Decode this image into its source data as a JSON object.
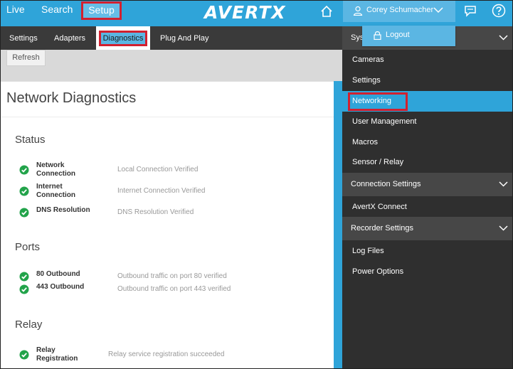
{
  "topnav": {
    "live": "Live",
    "search": "Search",
    "setup": "Setup",
    "logo": "AVERTX",
    "user_name": "Corey Schumacher",
    "logout": "Logout"
  },
  "subnav": {
    "tabs": [
      "Settings",
      "Adapters",
      "Diagnostics",
      "Plug And Play"
    ],
    "active": "Diagnostics"
  },
  "toolbar": {
    "refresh": "Refresh"
  },
  "main": {
    "title": "Network Diagnostics",
    "sections": [
      {
        "title": "Status",
        "rows": [
          {
            "label": "Network Connection",
            "value": "Local Connection Verified"
          },
          {
            "label": "Internet Connection",
            "value": "Internet Connection Verified"
          },
          {
            "label": "DNS Resolution",
            "value": "DNS Resolution Verified"
          }
        ]
      },
      {
        "title": "Ports",
        "rows": [
          {
            "label": "80 Outbound",
            "value": "Outbound traffic on port 80 verified"
          },
          {
            "label": "443 Outbound",
            "value": "Outbound traffic on port 443 verified"
          }
        ]
      },
      {
        "title": "Relay",
        "rows": [
          {
            "label": "Relay Registration",
            "value": "Relay service registration succeeded"
          }
        ]
      }
    ]
  },
  "sidebar": {
    "system_header": "Sys",
    "system_items": [
      "Cameras",
      "Settings",
      "Networking",
      "User Management",
      "Macros",
      "Sensor / Relay"
    ],
    "active_item": "Networking",
    "connection_header": "Connection Settings",
    "connection_items": [
      "AvertX Connect"
    ],
    "recorder_header": "Recorder Settings",
    "recorder_items": [
      "Log Files",
      "Power Options"
    ]
  },
  "colors": {
    "accent_blue": "#2fa4d9",
    "highlight_red": "#d2202f",
    "status_green": "#22a34a",
    "dark_panel": "#2f2f2f"
  },
  "icons": [
    "home-icon",
    "user-icon",
    "chevron-down-icon",
    "chat-icon",
    "help-icon",
    "lock-icon",
    "check-icon"
  ]
}
